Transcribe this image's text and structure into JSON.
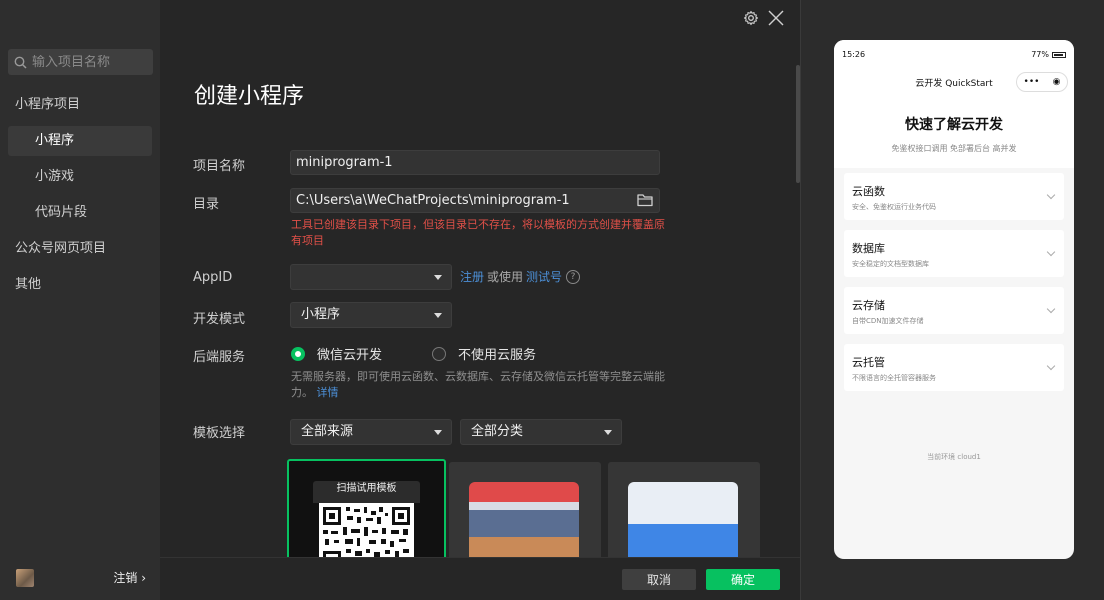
{
  "sidebar": {
    "search_placeholder": "输入项目名称",
    "items": [
      {
        "label": "小程序项目"
      },
      {
        "label": "小程序"
      },
      {
        "label": "小游戏"
      },
      {
        "label": "代码片段"
      },
      {
        "label": "公众号网页项目"
      },
      {
        "label": "其他"
      }
    ],
    "active_item": "小程序",
    "logout_label": "注销 ›"
  },
  "main": {
    "title": "创建小程序",
    "form": {
      "project_name": {
        "label": "项目名称",
        "value": "miniprogram-1"
      },
      "directory": {
        "label": "目录",
        "value": "C:\\Users\\a\\WeChatProjects\\miniprogram-1",
        "warning": "工具已创建该目录下项目，但该目录已不存在，将以模板的方式创建并覆盖原有项目"
      },
      "appid": {
        "label": "AppID",
        "value": "",
        "register_link": "注册",
        "or_use": "或使用",
        "test_link": "测试号",
        "help": "?"
      },
      "dev_mode": {
        "label": "开发模式",
        "value": "小程序"
      },
      "backend": {
        "label": "后端服务",
        "options": [
          {
            "label": "微信云开发",
            "selected": true
          },
          {
            "label": "不使用云服务",
            "selected": false
          }
        ],
        "description": "无需服务器，即可使用云函数、云数据库、云存储及微信云托管等完整云端能力。",
        "details_link": "详情"
      },
      "template": {
        "label": "模板选择",
        "source_value": "全部来源",
        "category_value": "全部分类",
        "qr_card_label": "扫描试用模板"
      }
    },
    "buttons": {
      "cancel": "取消",
      "ok": "确定"
    }
  },
  "preview": {
    "status_time": "15:26",
    "status_battery": "77%",
    "nav_title": "云开发 QuickStart",
    "heading": "快速了解云开发",
    "subheading": "免鉴权接口调用 免部署后台 高并发",
    "cards": [
      {
        "title": "云函数",
        "desc": "安全、免鉴权运行业务代码"
      },
      {
        "title": "数据库",
        "desc": "安全稳定的文档型数据库"
      },
      {
        "title": "云存储",
        "desc": "自带CDN加速文件存储"
      },
      {
        "title": "云托管",
        "desc": "不限语言的全托管容器服务"
      }
    ],
    "env_text": "当前环境 cloud1"
  },
  "colors": {
    "accent": "#07c160",
    "link": "#4c8fd6",
    "warning": "#e05048"
  }
}
